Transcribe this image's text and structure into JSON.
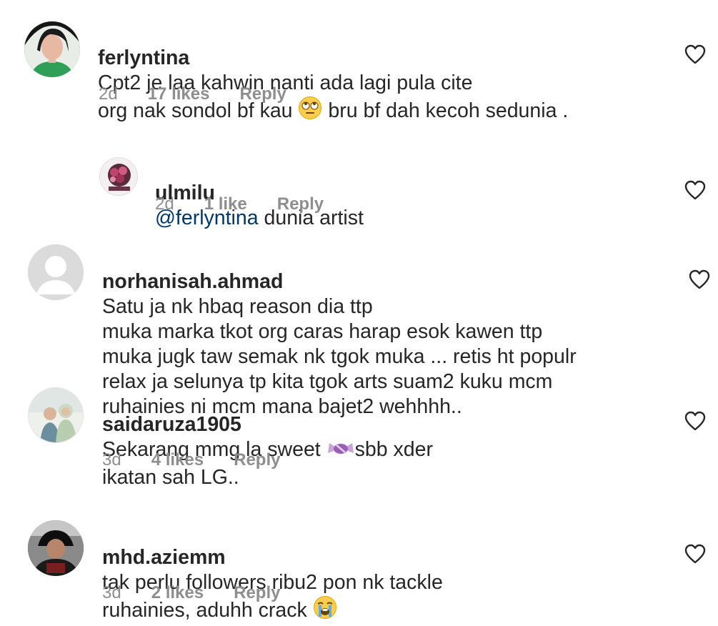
{
  "comments": [
    {
      "username": "ferlyntina",
      "text_a": "Cpt2 je laa kahwin nanti ada lagi pula cite\norg nak sondol bf kau ",
      "emoji": "face-with-rolling-eyes",
      "text_b": " bru bf dah kecoh sedunia .",
      "time": "2d",
      "likes": "17 likes",
      "reply": "Reply"
    },
    {
      "username": "ulmilu",
      "mention": "@ferlyntina",
      "text": " dunia artist",
      "time": "2d",
      "likes": "1 like",
      "reply": "Reply"
    },
    {
      "username": "norhanisah.ahmad",
      "text": "Satu ja nk hbaq reason dia ttp\nmuka marka tkot org caras harap esok kawen ttp\nmuka jugk taw semak nk tgok muka ... retis ht populr\nrelax ja selunya tp kita tgok arts suam2 kuku mcm\nruhainies ni mcm mana bajet2 wehhhh.."
    },
    {
      "username": "saidaruza1905",
      "text_a": "Sekarang mmg la sweet ",
      "emoji": "candy",
      "text_b": "sbb xder\nikatan sah LG..",
      "time": "3d",
      "likes": "4 likes",
      "reply": "Reply"
    },
    {
      "username": "mhd.aziemm",
      "text_a": "tak perlu followers ribu2 pon nk tackle\nruhainies, aduhh crack ",
      "emoji": "loudly-crying-face",
      "time": "3d",
      "likes": "2 likes",
      "reply": "Reply"
    }
  ],
  "icons": {
    "like": "heart-outline-icon",
    "default_avatar": "default-avatar-icon"
  },
  "colors": {
    "text": "#262626",
    "muted": "#8e8e8e",
    "mention": "#00376b",
    "heart": "#262626"
  }
}
